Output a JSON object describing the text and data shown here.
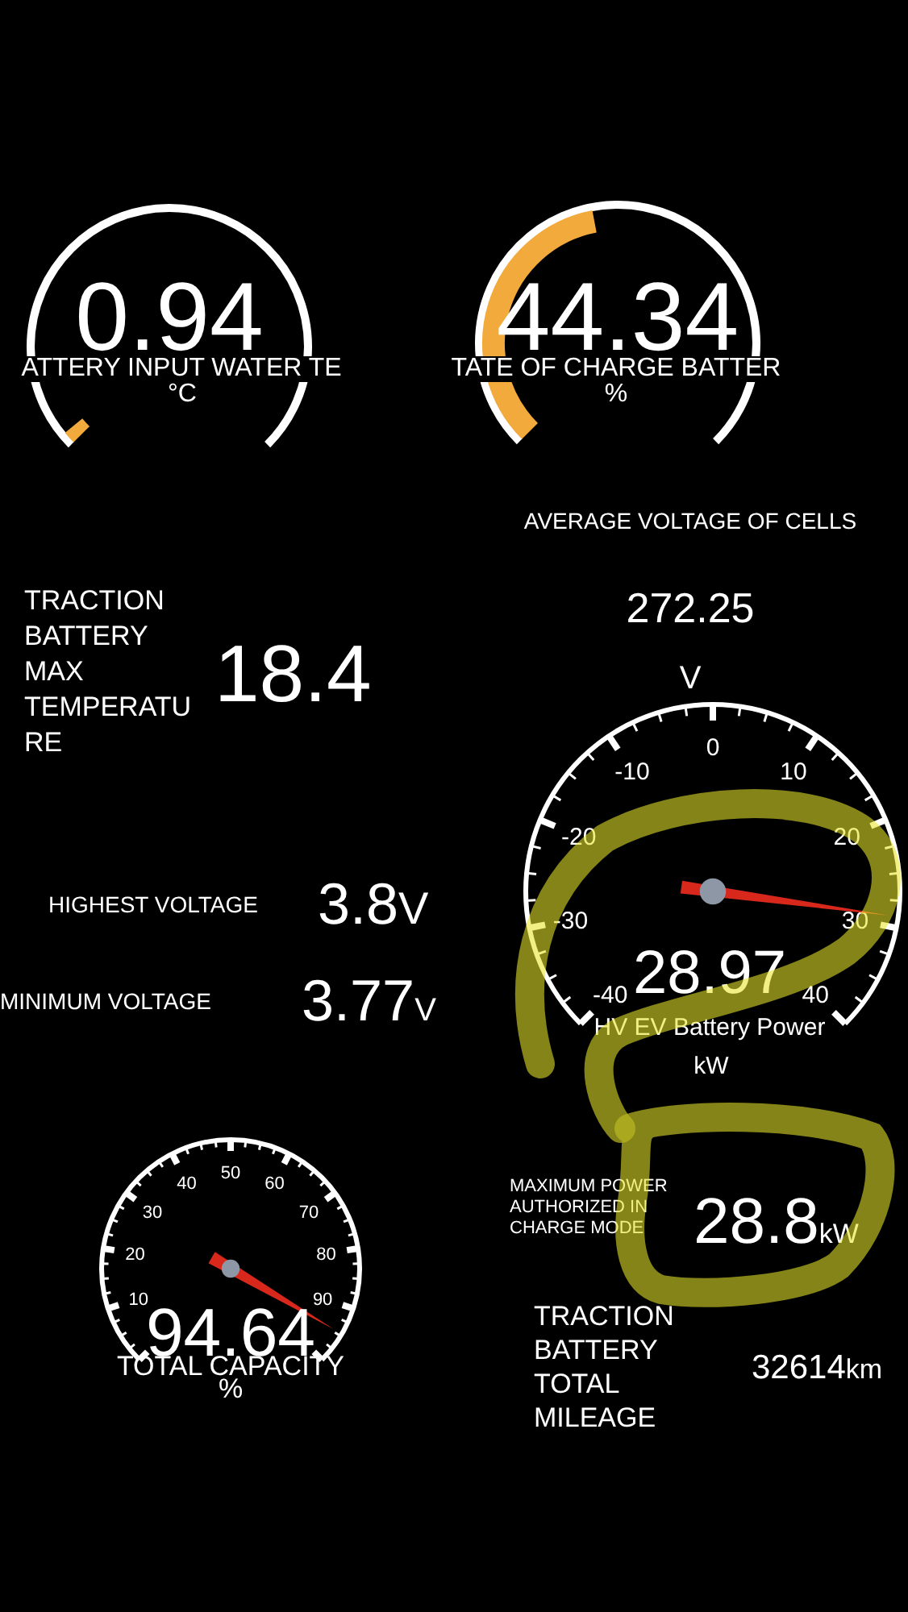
{
  "arc_gauges": [
    {
      "value": "0.94",
      "label": "ATTERY INPUT WATER TE",
      "unit": "°C"
    },
    {
      "value": "44.34",
      "label": "TATE OF CHARGE BATTER",
      "unit": "%"
    }
  ],
  "average_voltage": {
    "label": "AVERAGE VOLTAGE OF CELLS",
    "value": "272.25",
    "unit": "V"
  },
  "max_temperature": {
    "label": "TRACTION BATTERY MAX TEMPERATURE",
    "value": "18.4"
  },
  "voltages": [
    {
      "label": "HIGHEST VOLTAGE",
      "value": "3.8",
      "unit": "V"
    },
    {
      "label": "MINIMUM VOLTAGE",
      "value": "3.77",
      "unit": "V"
    }
  ],
  "dial_gauges": [
    {
      "ticks": [
        "-40",
        "-30",
        "-20",
        "-10",
        "0",
        "10",
        "20",
        "30",
        "40"
      ],
      "value": "28.97",
      "label": "HV EV Battery Power",
      "unit": "kW"
    },
    {
      "ticks": [
        "10",
        "20",
        "30",
        "40",
        "50",
        "60",
        "70",
        "80",
        "90"
      ],
      "value": "94.64",
      "label": "TOTAL CAPACITY",
      "unit": "%"
    }
  ],
  "max_power": {
    "label": "MAXIMUM POWER AUTHORIZED IN CHARGE MODE",
    "value": "28.8",
    "unit": "kW"
  },
  "mileage": {
    "label": "TRACTION BATTERY TOTAL MILEAGE",
    "value": "32614",
    "unit": "km"
  }
}
